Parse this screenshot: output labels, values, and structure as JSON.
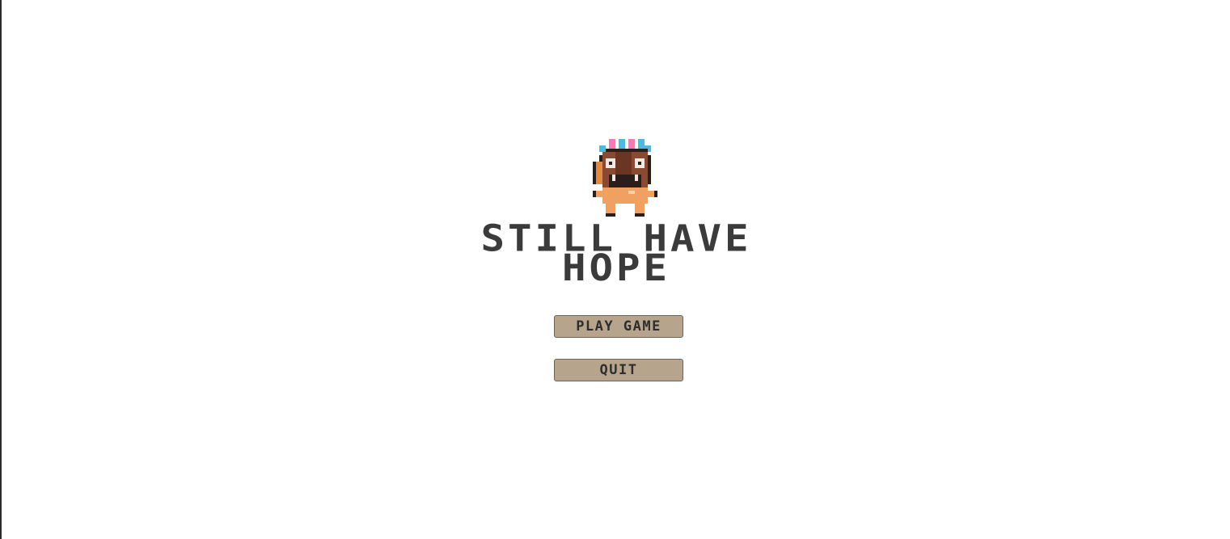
{
  "game": {
    "title_line1": "STILL HAVE",
    "title_line2": "HOPE",
    "mascot_icon": "tiki-mask-character-icon"
  },
  "menu": {
    "play_label": "PLAY GAME",
    "quit_label": "QUIT"
  },
  "colors": {
    "background": "#ffffff",
    "title_text": "#3b3b3b",
    "button_fill": "#b6a58c",
    "button_border": "#6e6253",
    "button_text": "#2e2e2e"
  }
}
